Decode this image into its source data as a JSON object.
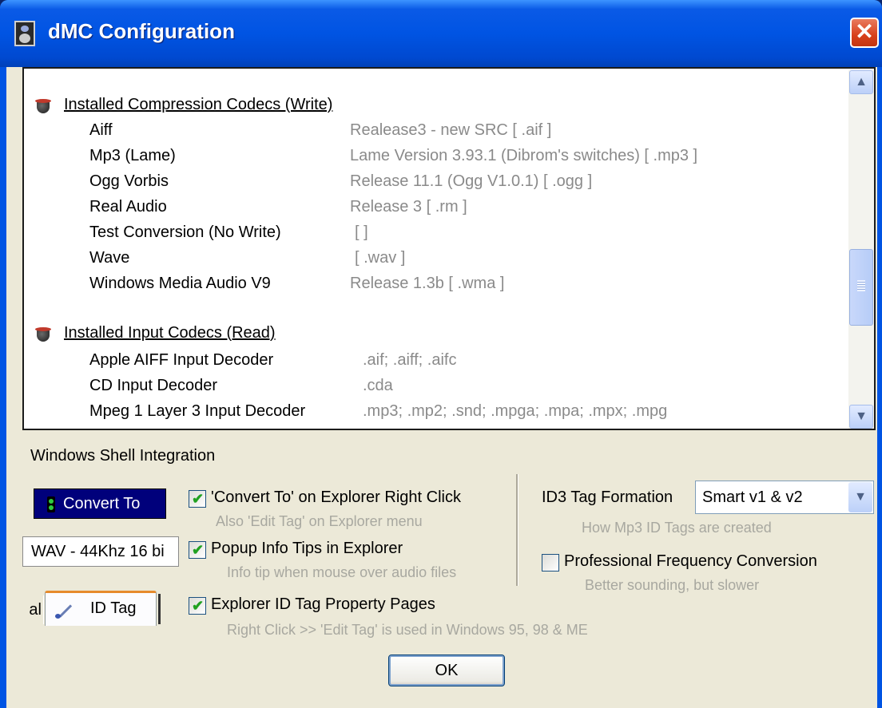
{
  "window": {
    "title": "dMC Configuration",
    "close_glyph": "✕"
  },
  "codecs": {
    "write_heading": "Installed Compression Codecs (Write)",
    "write_rows": [
      {
        "name": "Aiff",
        "value": "Realease3 - new SRC [ .aif ]"
      },
      {
        "name": "Mp3 (Lame)",
        "value": "Lame Version 3.93.1 (Dibrom's switches) [ .mp3 ]"
      },
      {
        "name": "Ogg Vorbis",
        "value": "Release 11.1 (Ogg V1.0.1) [ .ogg ]"
      },
      {
        "name": "Real Audio",
        "value": "Release 3 [ .rm ]"
      },
      {
        "name": "Test Conversion (No Write)",
        "value": "[ ]"
      },
      {
        "name": "Wave",
        "value": "[ .wav ]"
      },
      {
        "name": "Windows Media Audio V9",
        "value": "Release 1.3b [ .wma ]"
      }
    ],
    "read_heading": "Installed Input Codecs (Read)",
    "read_rows": [
      {
        "name": "Apple AIFF Input Decoder",
        "value": ".aif; .aiff; .aifc"
      },
      {
        "name": "CD Input Decoder",
        "value": ".cda"
      },
      {
        "name": "Mpeg 1 Layer 3 Input Decoder",
        "value": ".mp3; .mp2; .snd; .mpga; .mpa; .mpx; .mpg"
      }
    ],
    "scroll_up_glyph": "▲",
    "scroll_down_glyph": "▼"
  },
  "shell": {
    "group_label": "Windows Shell Integration",
    "convert_to_label": "Convert To",
    "format_value": "WAV - 44Khz 16 bi",
    "tab_prev_fragment": "al",
    "tab_id_tag_label": "ID Tag",
    "options": [
      {
        "label": "'Convert To' on Explorer Right Click",
        "hint": "Also 'Edit Tag' on Explorer menu",
        "checked": true
      },
      {
        "label": "Popup Info Tips in Explorer",
        "hint": "Info tip when mouse over audio files",
        "checked": true
      },
      {
        "label": "Explorer ID Tag Property Pages",
        "hint": "Right Click >> 'Edit Tag' is used in Windows 95, 98 & ME",
        "checked": true
      }
    ],
    "check_glyph": "✔"
  },
  "id3": {
    "label": "ID3 Tag Formation",
    "selected": "Smart v1 & v2",
    "hint": "How Mp3 ID Tags are created",
    "dropdown_glyph": "▼"
  },
  "freq": {
    "label": "Professional Frequency Conversion",
    "hint": "Better sounding, but slower",
    "checked": false
  },
  "buttons": {
    "ok_label": "OK"
  },
  "colors": {
    "title_bar": "#0054e3",
    "close_button": "#d8401b",
    "dialog_bg": "#ece9d8",
    "hint_text": "#a8a8a0"
  }
}
